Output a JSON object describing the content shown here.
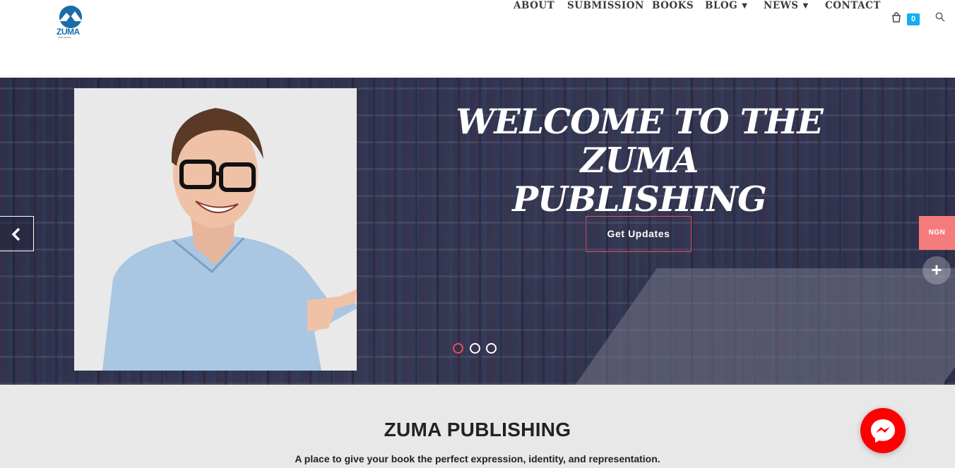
{
  "logo": {
    "text": "ZUMA",
    "subtext": "PUBLISHING"
  },
  "nav": {
    "items": [
      {
        "label": "ABOUT",
        "has_dropdown": false
      },
      {
        "label": "SUBMISSION",
        "has_dropdown": false
      },
      {
        "label": "BOOKS",
        "has_dropdown": false
      },
      {
        "label": "BLOG",
        "has_dropdown": true
      },
      {
        "label": "NEWS",
        "has_dropdown": true
      },
      {
        "label": "CONTACT",
        "has_dropdown": false
      }
    ],
    "cart_count": "0",
    "cart_icon": "shopping-bag-icon",
    "search_icon": "search-icon",
    "accent": "#13aff0"
  },
  "hero": {
    "title_line1": "WELCOME TO THE",
    "title_line2": "ZUMA PUBLISHING",
    "button_label": "Get Updates",
    "button_border": "#e8505b",
    "slides": 3,
    "active_slide": 1,
    "prev_icon": "chevron-left-icon"
  },
  "side_widgets": {
    "currency_label": "NGN",
    "currency_color": "#f57c7c",
    "expand_icon": "plus-icon"
  },
  "intro": {
    "title": "ZUMA PUBLISHING",
    "subtitle": "A place to give your book the perfect expression, identity, and representation."
  },
  "messenger": {
    "icon": "messenger-icon",
    "color": "#ff0000"
  }
}
